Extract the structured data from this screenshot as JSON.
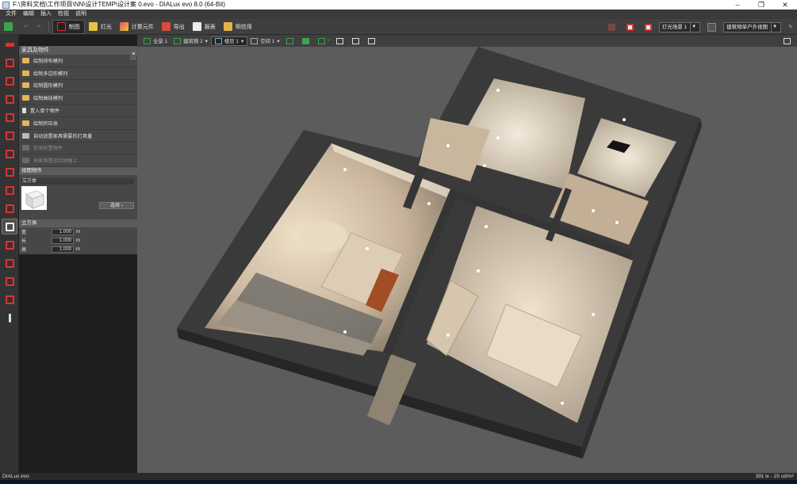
{
  "window": {
    "title": "F:\\资料文档\\工作项目\\NN\\设计TEMP\\设计案 0.evo - DIALux evo 8.0  (64-Bit)",
    "minimize": "–",
    "maximize": "❐",
    "close": "✕"
  },
  "menu": [
    "文件",
    "编辑",
    "插入",
    "检视",
    "说明"
  ],
  "zoom": {
    "value": "94",
    "unit": "%",
    "mode": "爆炸"
  },
  "toolbar": {
    "buttons": [
      "制图",
      "灯光",
      "计算元件",
      "导出",
      "报表",
      "明信用"
    ],
    "active": "制图",
    "scene_combo": "灯光场景 1",
    "view_combo": "建筑物单户外视图"
  },
  "view_toolbar": {
    "items": [
      "全景 1",
      "建筑物 2",
      "楼层 1",
      "空间 1"
    ],
    "active": "楼层 1"
  },
  "panel": {
    "header": "家具及物件",
    "items": [
      "绘制排布模列",
      "绘制多边形模列",
      "绘制圆形模列",
      "绘制曲线模列",
      "置入单个物件",
      "绘制挤压体",
      "自动放置家具需要的灯具量",
      "检测布置物件",
      "将家具置放到地面上"
    ],
    "disabled": [
      7,
      8
    ],
    "selected_header": "视图物件",
    "object_name": "立方体",
    "select_button": "选择",
    "dims_header": "立方体",
    "dims": [
      {
        "label": "宽",
        "value": "1.000",
        "unit": "m"
      },
      {
        "label": "长",
        "value": "1.000",
        "unit": "m"
      },
      {
        "label": "高",
        "value": "1.000",
        "unit": "m"
      }
    ]
  },
  "status": {
    "left": "DIALux evo",
    "right": "391 lx - 25 cd/m²"
  },
  "colors": {
    "accent": "#d33a2f",
    "floor": "#d8c7ad",
    "wall": "#3a3a3a"
  }
}
